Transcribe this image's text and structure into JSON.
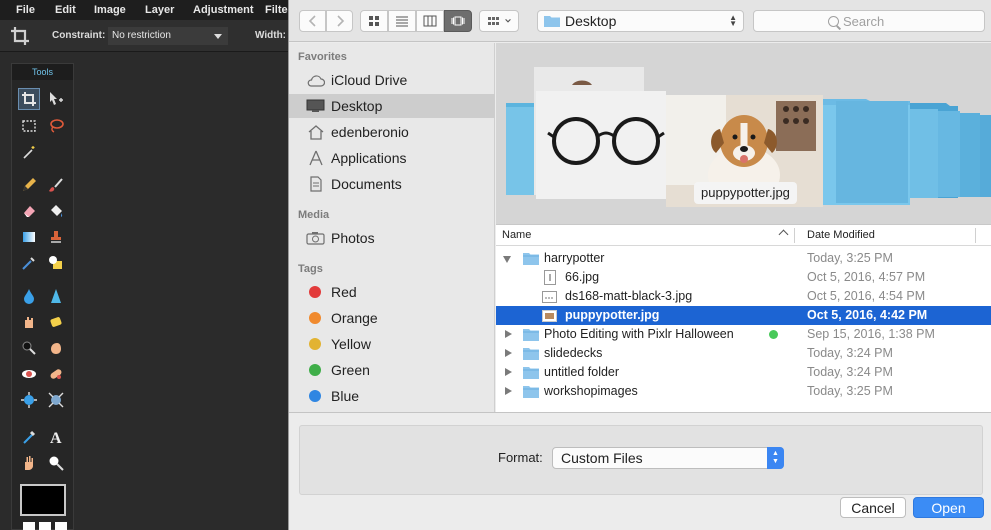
{
  "editor": {
    "menu": [
      "File",
      "Edit",
      "Image",
      "Layer",
      "Adjustment",
      "Filter"
    ],
    "options": {
      "constraint_label": "Constraint:",
      "constraint_value": "No restriction",
      "width_label": "Width:"
    },
    "tools_title": "Tools",
    "tools": [
      "crop-tool",
      "move-tool",
      "marquee-tool",
      "lasso-tool",
      "wand-tool",
      "pencil-tool",
      "brush-tool",
      "eraser-tool",
      "bucket-tool",
      "gradient-tool",
      "stamp-tool",
      "color-replace-tool",
      "drawing-tool",
      "blur-tool",
      "sharpen-tool",
      "smudge-tool",
      "sponge-tool",
      "dodge-tool",
      "burn-tool",
      "redeye-tool",
      "spot-heal-tool",
      "bloat-tool",
      "pinch-tool",
      "color-picker-tool",
      "type-tool",
      "hand-tool",
      "zoom-tool"
    ],
    "colors": {
      "primary": "#000000",
      "secondary": "#ffffff"
    }
  },
  "dialog": {
    "location": "Desktop",
    "search_placeholder": "Search",
    "view_mode": "cover-flow",
    "sidebar": {
      "favorites_title": "Favorites",
      "favorites": [
        {
          "label": "iCloud Drive",
          "icon": "cloud-icon"
        },
        {
          "label": "Desktop",
          "icon": "desktop-icon",
          "selected": true
        },
        {
          "label": "edenberonio",
          "icon": "home-icon"
        },
        {
          "label": "Applications",
          "icon": "applications-icon"
        },
        {
          "label": "Documents",
          "icon": "documents-icon"
        }
      ],
      "media_title": "Media",
      "media": [
        {
          "label": "Photos",
          "icon": "camera-icon"
        }
      ],
      "tags_title": "Tags",
      "tags": [
        {
          "label": "Red",
          "color": "#e23b3b"
        },
        {
          "label": "Orange",
          "color": "#f08a2e"
        },
        {
          "label": "Yellow",
          "color": "#e2b332"
        },
        {
          "label": "Green",
          "color": "#3fae49"
        },
        {
          "label": "Blue",
          "color": "#2f86e2"
        }
      ]
    },
    "coverflow_caption": "puppypotter.jpg",
    "columns": {
      "name": "Name",
      "date": "Date Modified"
    },
    "rows": [
      {
        "name": "harrypotter",
        "date": "Today, 3:25 PM",
        "kind": "folder",
        "expanded": true,
        "indent": 0
      },
      {
        "name": "66.jpg",
        "date": "Oct 5, 2016, 4:57 PM",
        "kind": "file",
        "indent": 1
      },
      {
        "name": "ds168-matt-black-3.jpg",
        "date": "Oct 5, 2016, 4:54 PM",
        "kind": "file",
        "indent": 1
      },
      {
        "name": "puppypotter.jpg",
        "date": "Oct 5, 2016, 4:42 PM",
        "kind": "file",
        "indent": 1,
        "selected": true
      },
      {
        "name": "Photo Editing with  Pixlr Halloween",
        "date": "Sep 15, 2016, 1:38 PM",
        "kind": "folder",
        "indent": 0,
        "tag": "#49c95a"
      },
      {
        "name": "slidedecks",
        "date": "Today, 3:24 PM",
        "kind": "folder",
        "indent": 0
      },
      {
        "name": "untitled folder",
        "date": "Today, 3:24 PM",
        "kind": "folder",
        "indent": 0
      },
      {
        "name": "workshopimages",
        "date": "Today, 3:25 PM",
        "kind": "folder",
        "indent": 0
      }
    ],
    "format_label": "Format:",
    "format_value": "Custom Files",
    "cancel_label": "Cancel",
    "open_label": "Open",
    "accent": "#1c64d3"
  }
}
